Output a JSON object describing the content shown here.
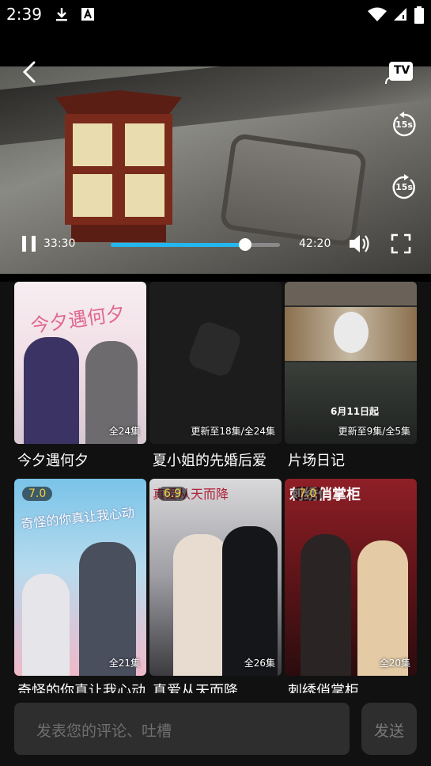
{
  "status_bar": {
    "time": "2:39",
    "icons": [
      "download-icon",
      "a-square-icon",
      "wifi-icon",
      "signal-icon",
      "battery-icon"
    ]
  },
  "player": {
    "tv_label": "TV",
    "rewind_label": "15s",
    "forward_label": "15s",
    "current_time": "33:30",
    "total_time": "42:20",
    "progress": 0.795,
    "accent": "#22b7f0"
  },
  "cards": [
    {
      "title": "今夕遇何夕",
      "episodes": "全24集",
      "rating": "",
      "poster_text": "今夕遇何夕"
    },
    {
      "title": "夏小姐的先婚后爱",
      "episodes": "更新至18集/全24集",
      "rating": ""
    },
    {
      "title": "片场日记",
      "episodes": "更新至9集/全5集",
      "rating": "",
      "poster_text": "6月11日起"
    },
    {
      "title": "奇怪的你真让我心动",
      "episodes": "全21集",
      "rating": "7.0",
      "poster_text": "奇怪的你真让我心动"
    },
    {
      "title": "真爱从天而降",
      "episodes": "全26集",
      "rating": "6.9",
      "poster_text": "真爱从天而降"
    },
    {
      "title": "刺绣俏掌柜",
      "episodes": "全20集",
      "rating": "7.0",
      "poster_text": "刺绣俏掌柜"
    }
  ],
  "comment": {
    "placeholder": "发表您的评论、吐槽",
    "send_label": "发送"
  }
}
